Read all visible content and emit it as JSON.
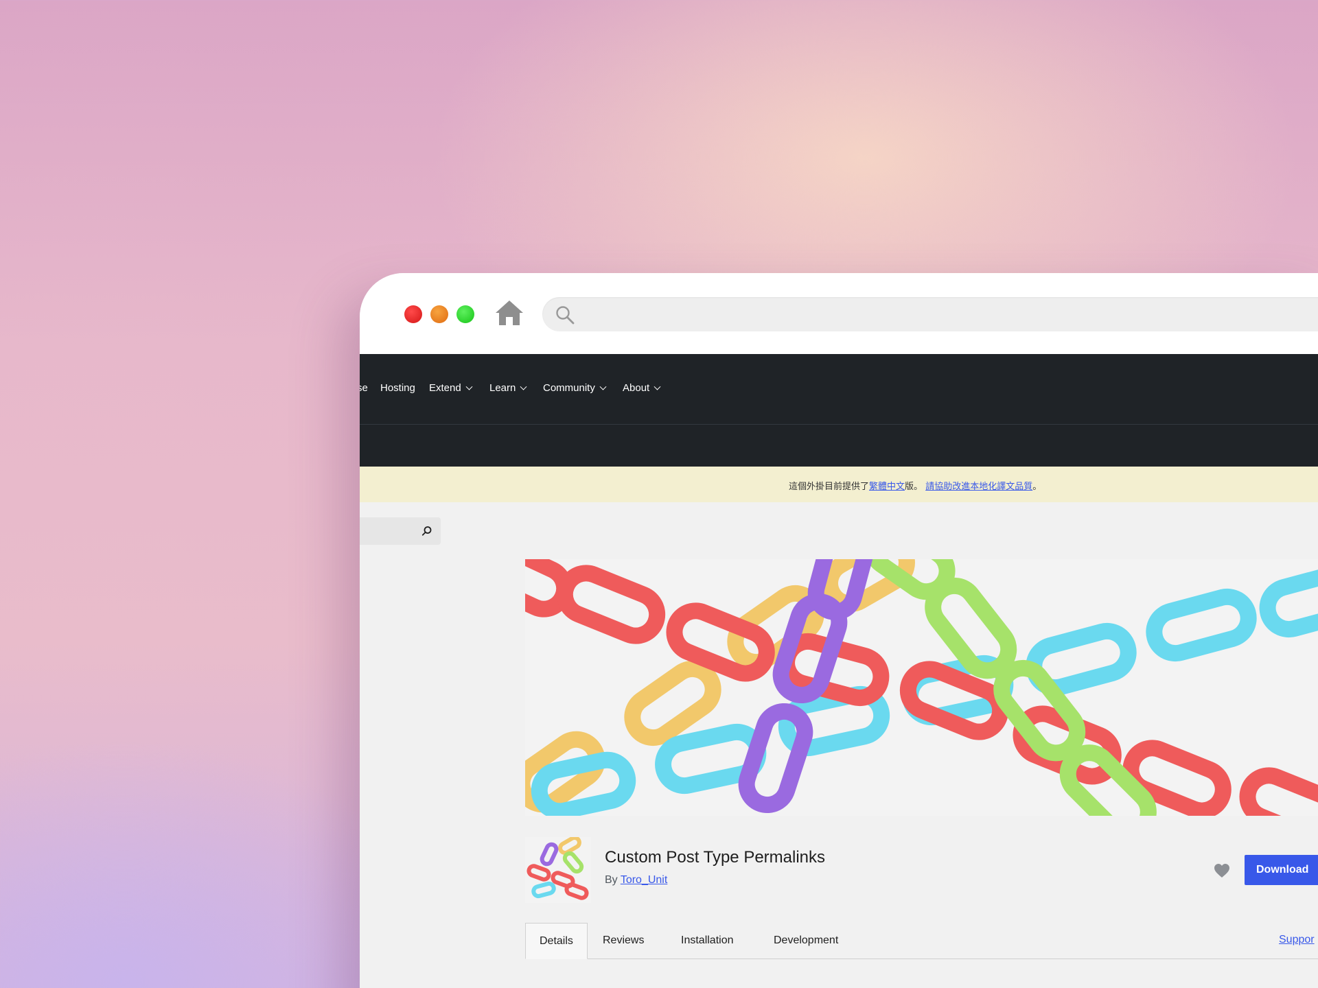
{
  "nav": {
    "items": [
      {
        "label": "se",
        "dropdown": false
      },
      {
        "label": "Hosting",
        "dropdown": false
      },
      {
        "label": "Extend",
        "dropdown": true
      },
      {
        "label": "Learn",
        "dropdown": true
      },
      {
        "label": "Community",
        "dropdown": true
      },
      {
        "label": "About",
        "dropdown": true
      }
    ]
  },
  "notice": {
    "prefix": "這個外掛目前提供了",
    "link1": "繁體中文",
    "middle": "版。",
    "link2": "請協助改進本地化譯文品質",
    "suffix": "。"
  },
  "plugin": {
    "title": "Custom Post Type Permalinks",
    "by_label": "By",
    "author": "Toro_Unit",
    "download_label": "Download"
  },
  "tabs": [
    {
      "label": "Details",
      "active": true
    },
    {
      "label": "Reviews",
      "active": false
    },
    {
      "label": "Installation",
      "active": false
    },
    {
      "label": "Development",
      "active": false
    }
  ],
  "support_label": "Suppor",
  "colors": {
    "nav_bg": "#1f2327",
    "notice_bg": "#f3efd0",
    "accent": "#3858e9",
    "chain_red": "#ef5b5b",
    "chain_yellow": "#f2c86b",
    "chain_cyan": "#6ad9ef",
    "chain_purple": "#9a6ae0",
    "chain_green": "#a6e26a"
  },
  "icons": [
    "close-dot",
    "minimize-dot",
    "zoom-dot",
    "home-icon",
    "search-icon",
    "heart-icon",
    "chevron-down-icon"
  ]
}
